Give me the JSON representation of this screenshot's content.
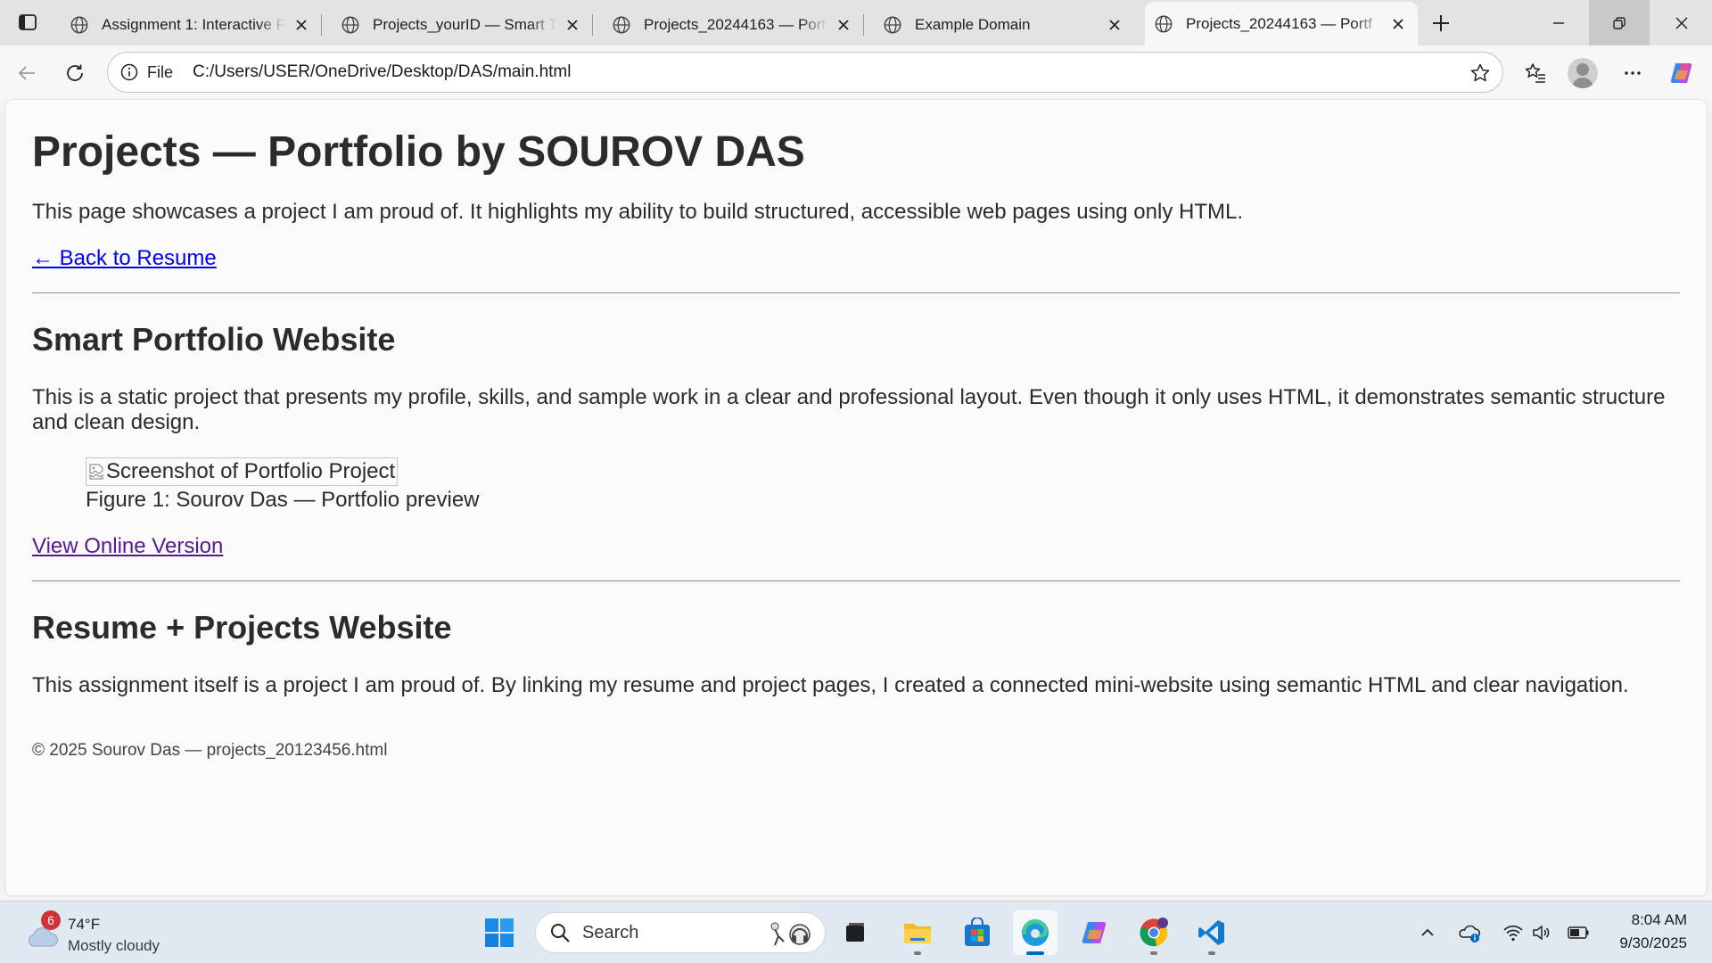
{
  "browser": {
    "tabs": [
      {
        "title": "Assignment 1: Interactive R",
        "active": false
      },
      {
        "title": "Projects_yourID — Smart T",
        "active": false
      },
      {
        "title": "Projects_20244163 — Portf",
        "active": false
      },
      {
        "title": "Example Domain",
        "active": false
      },
      {
        "title": "Projects_20244163 — Portf",
        "active": true
      }
    ],
    "address": {
      "scheme_label": "File",
      "url": "C:/Users/USER/OneDrive/Desktop/DAS/main.html"
    }
  },
  "page": {
    "title": "Projects — Portfolio by SOUROV DAS",
    "intro": "This page showcases a project I am proud of. It highlights my ability to build structured, accessible web pages using only HTML.",
    "back_link": "← Back to Resume",
    "projects": [
      {
        "heading": "Smart Portfolio Website",
        "description": "This is a static project that presents my profile, skills, and sample work in a clear and professional layout. Even though it only uses HTML, it demonstrates semantic structure and clean design.",
        "image_alt": "Screenshot of Portfolio Project",
        "caption": "Figure 1: Sourov Das — Portfolio preview",
        "link": "View Online Version"
      },
      {
        "heading": "Resume + Projects Website",
        "description": "This assignment itself is a project I am proud of. By linking my resume and project pages, I created a connected mini-website using semantic HTML and clear navigation."
      }
    ],
    "footer": "© 2025 Sourov Das — projects_20123456.html"
  },
  "taskbar": {
    "weather": {
      "temp": "74°F",
      "condition": "Mostly cloudy",
      "badge": "6"
    },
    "search_placeholder": "Search",
    "clock": {
      "time": "8:04 AM",
      "date": "9/30/2025"
    },
    "apps": [
      "start-icon",
      "task-view-icon",
      "file-explorer-icon",
      "microsoft-store-icon",
      "edge-icon",
      "copilot-icon",
      "chrome-icon",
      "vscode-icon"
    ]
  },
  "colors": {
    "link": "#0000ee",
    "visited_link": "#551a8b",
    "accent": "#0067c0",
    "badge": "#d13438"
  }
}
